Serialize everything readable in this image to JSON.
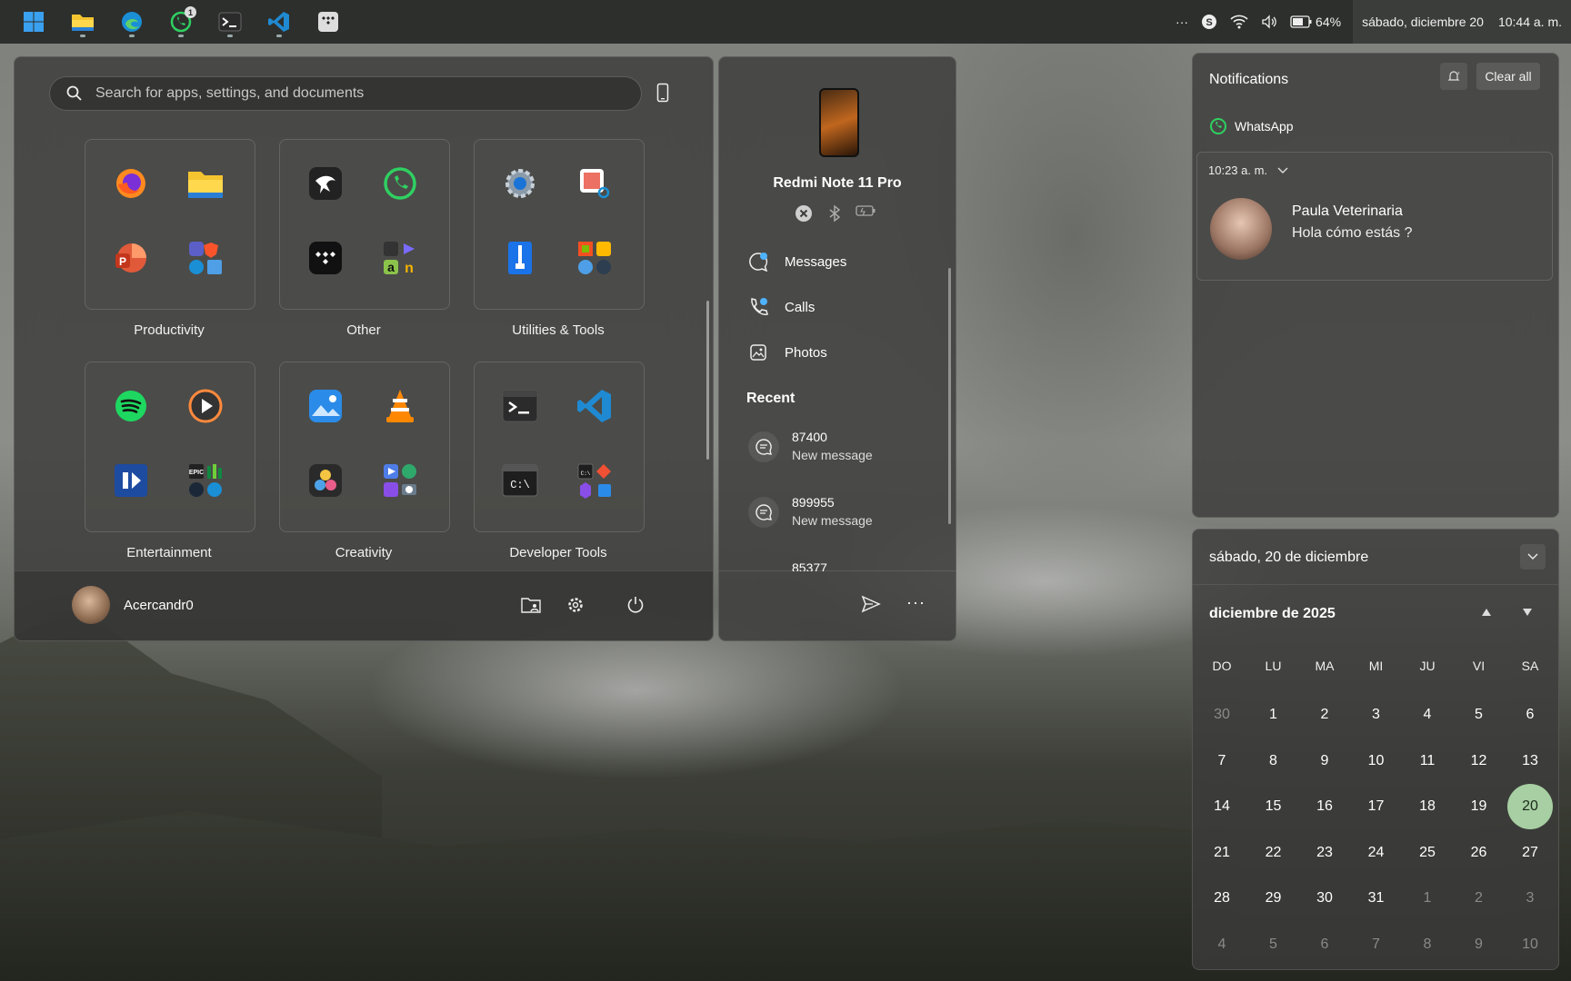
{
  "taskbar": {
    "apps": [
      {
        "name": "windows-start",
        "icon": "windows-logo"
      },
      {
        "name": "file-explorer",
        "icon": "folder-icon"
      },
      {
        "name": "edge",
        "icon": "edge-icon"
      },
      {
        "name": "whatsapp",
        "icon": "whatsapp-icon",
        "badge": "1"
      },
      {
        "name": "terminal",
        "icon": "terminal-icon"
      },
      {
        "name": "vscode",
        "icon": "vscode-icon"
      },
      {
        "name": "tidal",
        "icon": "tidal-icon"
      }
    ],
    "battery": "64%",
    "date": "sábado, diciembre 20",
    "time": "10:44 a. m."
  },
  "start": {
    "search_placeholder": "Search for apps, settings, and documents",
    "folders": [
      {
        "label": "Productivity"
      },
      {
        "label": "Other"
      },
      {
        "label": "Utilities & Tools"
      },
      {
        "label": "Entertainment"
      },
      {
        "label": "Creativity"
      },
      {
        "label": "Developer Tools"
      }
    ],
    "user": "Acercandr0"
  },
  "phone": {
    "device_name": "Redmi Note 11 Pro",
    "items": [
      "Messages",
      "Calls",
      "Photos"
    ],
    "recent_heading": "Recent",
    "recent": [
      {
        "title": "87400",
        "subtitle": "New message"
      },
      {
        "title": "899955",
        "subtitle": "New message"
      },
      {
        "title": "85377",
        "subtitle": ""
      }
    ]
  },
  "notifications": {
    "title": "Notifications",
    "clear_label": "Clear all",
    "app": "WhatsApp",
    "time": "10:23 a. m.",
    "sender": "Paula Veterinaria",
    "message": "Hola cómo estás ?"
  },
  "calendar": {
    "header_date": "sábado, 20 de diciembre",
    "month": "diciembre de 2025",
    "weekdays": [
      "DO",
      "LU",
      "MA",
      "MI",
      "JU",
      "VI",
      "SA"
    ],
    "weeks": [
      [
        "30",
        "1",
        "2",
        "3",
        "4",
        "5",
        "6"
      ],
      [
        "7",
        "8",
        "9",
        "10",
        "11",
        "12",
        "13"
      ],
      [
        "14",
        "15",
        "16",
        "17",
        "18",
        "19",
        "20"
      ],
      [
        "21",
        "22",
        "23",
        "24",
        "25",
        "26",
        "27"
      ],
      [
        "28",
        "29",
        "30",
        "31",
        "1",
        "2",
        "3"
      ],
      [
        "4",
        "5",
        "6",
        "7",
        "8",
        "9",
        "10"
      ]
    ],
    "today": "20",
    "accent": "#a7cfa3"
  }
}
